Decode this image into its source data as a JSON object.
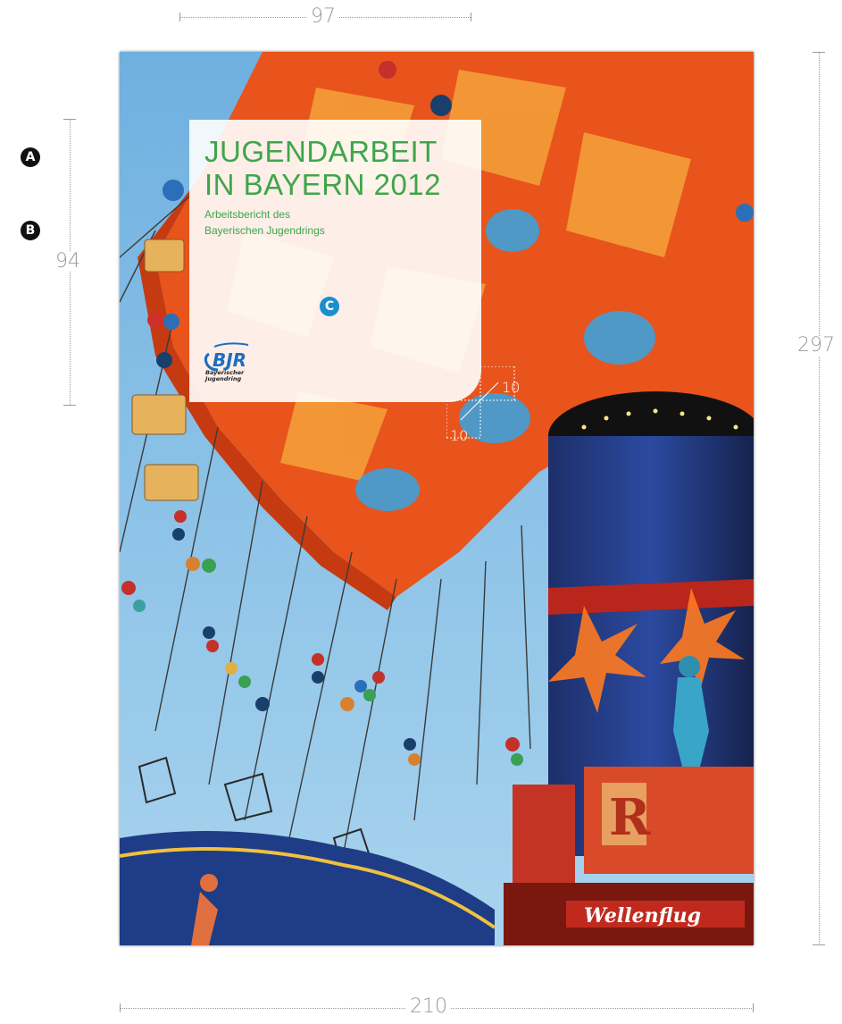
{
  "dimensions": {
    "top_width": "97",
    "panel_height": "94",
    "page_height": "297",
    "page_width": "210",
    "margin_a": "10",
    "margin_b": "10"
  },
  "markers": {
    "a": "A",
    "b": "B",
    "c": "C"
  },
  "cover": {
    "title": "JUGENDARBEIT\nIN BAYERN 2012",
    "subtitle": "Arbeitsbericht des\nBayerischen Jugendrings",
    "logo_text": "BJR",
    "logo_subtext": "Bayerischer\nJugendring",
    "sign_text": "Wellenflug",
    "letter_sign": "R"
  },
  "colors": {
    "title_green": "#3ea64a",
    "marker_blue": "#1b8ed0",
    "logo_blue": "#1b6fc0",
    "sky": "#8fc3e4",
    "carousel_orange": "#e8541c"
  }
}
